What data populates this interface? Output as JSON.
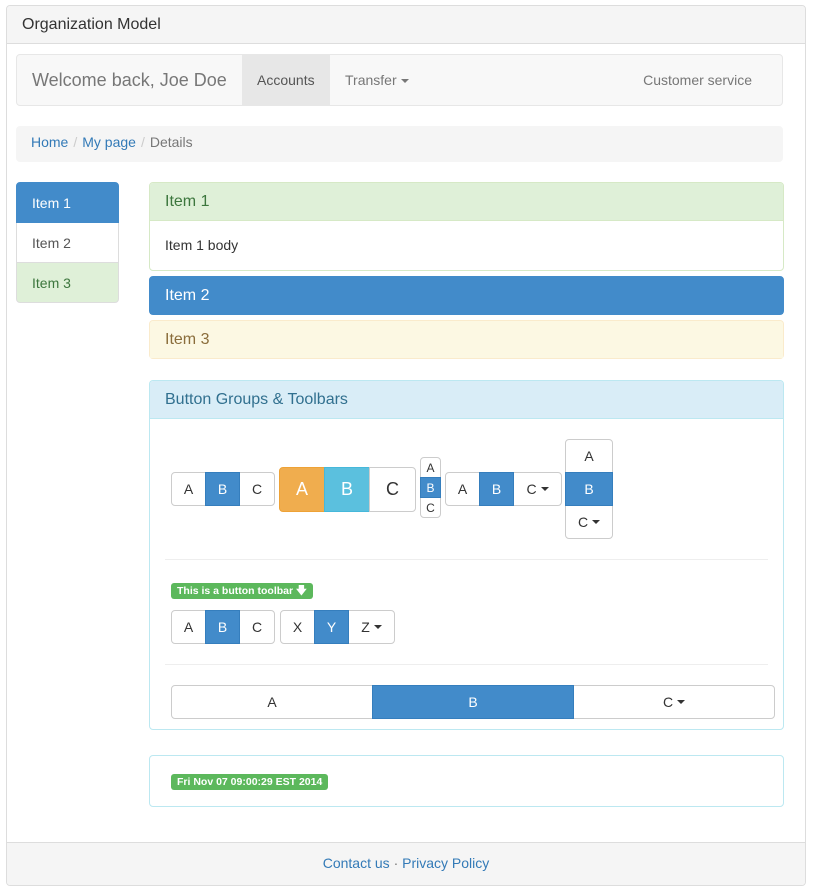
{
  "window": {
    "title": "Organization Model"
  },
  "navbar": {
    "brand": "Welcome back, Joe Doe",
    "items": [
      {
        "label": "Accounts",
        "active": true
      },
      {
        "label": "Transfer",
        "dropdown": true
      },
      {
        "label": "Customer service"
      }
    ]
  },
  "breadcrumb": {
    "items": [
      "Home",
      "My page",
      "Details"
    ],
    "separator": "/"
  },
  "sidebar": {
    "items": [
      {
        "label": "Item 1",
        "state": "active"
      },
      {
        "label": "Item 2"
      },
      {
        "label": "Item 3",
        "state": "success"
      }
    ]
  },
  "accordion": [
    {
      "title": "Item 1",
      "body": "Item 1 body",
      "style": "success",
      "expanded": true
    },
    {
      "title": "Item 2",
      "style": "primary",
      "expanded": false
    },
    {
      "title": "Item 3",
      "style": "warning",
      "expanded": false
    }
  ],
  "button_panel": {
    "title": "Button Groups & Toolbars",
    "group1": [
      "A",
      "B",
      "C"
    ],
    "group2_large": [
      "A",
      "B",
      "C"
    ],
    "group3_vertical_small": [
      "A",
      "B",
      "C"
    ],
    "group4_dropdown": [
      "A",
      "B",
      "C"
    ],
    "group5_vertical": [
      "A",
      "B",
      "C"
    ],
    "toolbar_label": "This is a button toolbar",
    "toolbar_groups": [
      [
        "A",
        "B",
        "C"
      ],
      [
        "X",
        "Y",
        "Z"
      ]
    ],
    "justified_group": [
      "A",
      "B",
      "C"
    ]
  },
  "timestamp_label": "Fri Nov 07 09:00:29 EST 2014",
  "footer": {
    "links": [
      "Contact us",
      "Privacy Policy"
    ],
    "separator": "·"
  },
  "colors": {
    "primary": "#428bca",
    "success": "#5cb85c",
    "warning": "#f0ad4e",
    "info": "#5bc0de"
  }
}
